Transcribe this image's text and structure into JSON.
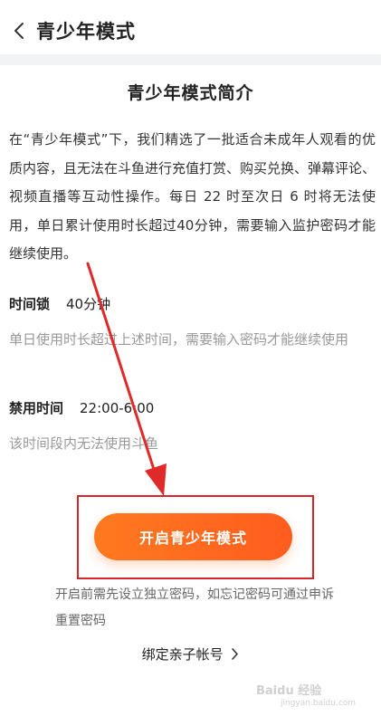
{
  "header": {
    "title": "青少年模式",
    "back_icon": "chevron-left-icon"
  },
  "intro": {
    "title": "青少年模式简介",
    "body": "在“青少年模式”下，我们精选了一批适合未成年人观看的优质内容，且无法在斗鱼进行充值打赏、购买兑换、弹幕评论、视频直播等互动性操作。每日 22 时至次日 6 时将无法使用，单日累计使用时长超过40分钟，需要输入监护密码才能继续使用。"
  },
  "settings": [
    {
      "label": "时间锁",
      "value": "40分钟",
      "description": "单日使用时长超过上述时间，需要输入密码才能继续使用"
    },
    {
      "label": "禁用时间",
      "value": "22:00-6:00",
      "description": "该时间段内无法使用斗鱼"
    }
  ],
  "action": {
    "button_label": "开启青少年模式",
    "notice": "开启前需先设立独立密码，如忘记密码可通过申诉重置密码",
    "link_label": "绑定亲子帐号"
  },
  "watermark": {
    "text": "Baidu 经验",
    "sub": "jingyan.baidu.com"
  },
  "colors": {
    "accent_start": "#ff7a1f",
    "accent_end": "#ff5c1f",
    "annotation_red": "#d9252a"
  }
}
